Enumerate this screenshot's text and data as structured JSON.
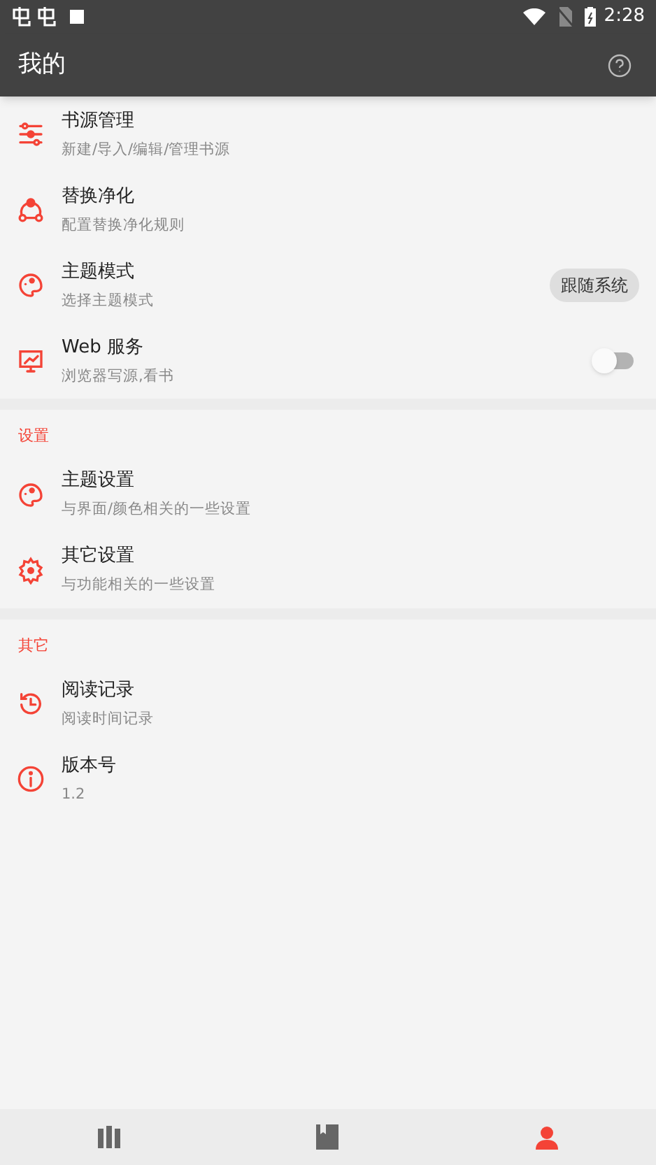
{
  "status_bar": {
    "time": "2:28"
  },
  "app_bar": {
    "title": "我的"
  },
  "sections": [
    {
      "items": [
        {
          "kind": "plain",
          "title": "书源管理",
          "subtitle": "新建/导入/编辑/管理书源"
        },
        {
          "kind": "plain",
          "title": "替换净化",
          "subtitle": "配置替换净化规则"
        },
        {
          "kind": "chip",
          "title": "主题模式",
          "subtitle": "选择主题模式",
          "value": "跟随系统"
        },
        {
          "kind": "switch",
          "title": "Web 服务",
          "subtitle": "浏览器写源,看书",
          "on": false
        }
      ]
    },
    {
      "header": "设置",
      "items": [
        {
          "kind": "plain",
          "title": "主题设置",
          "subtitle": "与界面/颜色相关的一些设置"
        },
        {
          "kind": "plain",
          "title": "其它设置",
          "subtitle": "与功能相关的一些设置"
        }
      ]
    },
    {
      "header": "其它",
      "items": [
        {
          "kind": "plain",
          "title": "阅读记录",
          "subtitle": "阅读时间记录"
        },
        {
          "kind": "plain",
          "title": "版本号",
          "subtitle": "1.2"
        }
      ]
    }
  ],
  "bottom_nav": [
    {
      "selected": false
    },
    {
      "selected": false
    },
    {
      "selected": true
    }
  ]
}
